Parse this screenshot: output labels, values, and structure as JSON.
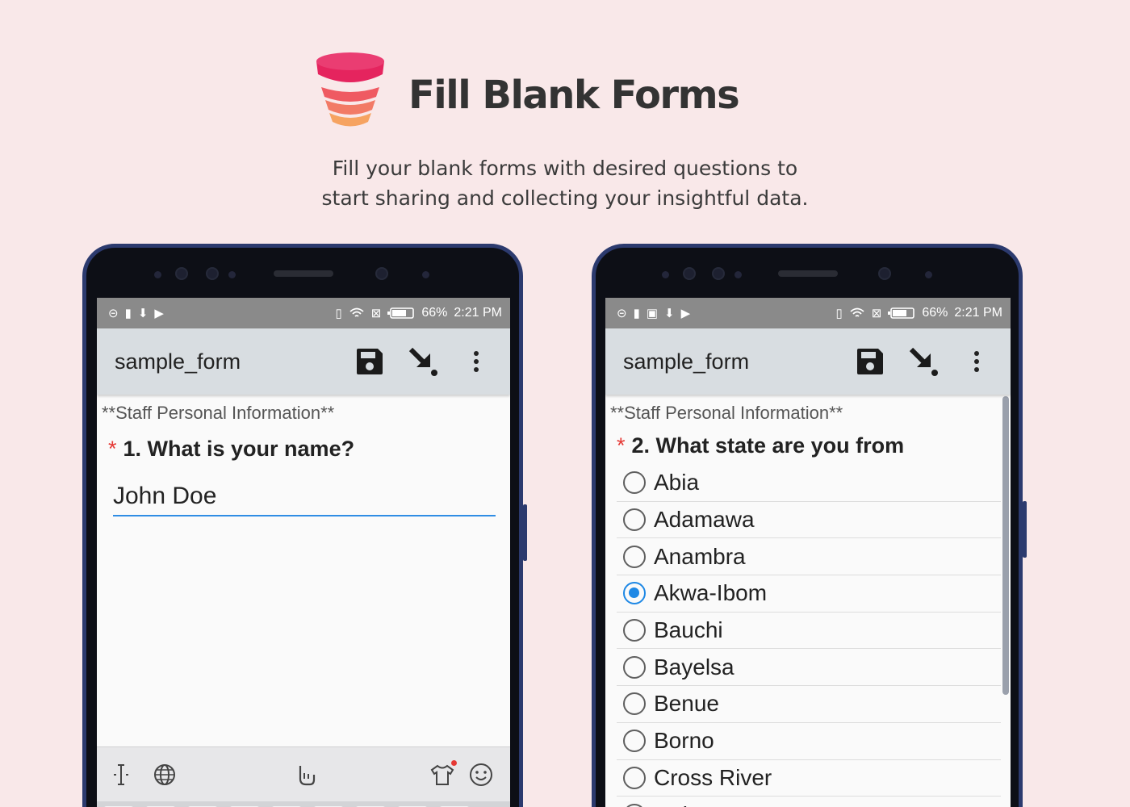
{
  "header": {
    "title": "Fill Blank Forms",
    "subtitle_line1": "Fill your blank forms with desired questions to",
    "subtitle_line2": "start sharing and collecting your insightful data."
  },
  "colors": {
    "background": "#f9e8e9",
    "logo_top": "#e5245e",
    "logo_bottom": "#f6a361",
    "accent_blue": "#1e88e5",
    "required_red": "#e53935"
  },
  "status_bar": {
    "battery": "66%",
    "time": "2:21 PM",
    "icons": [
      "notification-icon",
      "vibrate-icon",
      "wifi-icon",
      "sim-icon",
      "battery-icon"
    ]
  },
  "app_bar": {
    "title": "sample_form",
    "icons": [
      "save-icon",
      "jump-icon",
      "overflow-menu-icon"
    ]
  },
  "left_screen": {
    "section": "**Staff Personal Information**",
    "question_required_mark": "*",
    "question": "1. What is your name?",
    "answer_value": "John Doe",
    "keyboard_icons": [
      "cursor-icon",
      "globe-icon",
      "swipe-icon",
      "theme-icon",
      "emoji-icon"
    ]
  },
  "right_screen": {
    "section": "**Staff Personal Information**",
    "question_required_mark": "*",
    "question": "2. What state are you from",
    "options": [
      {
        "label": "Abia",
        "selected": false
      },
      {
        "label": "Adamawa",
        "selected": false
      },
      {
        "label": "Anambra",
        "selected": false
      },
      {
        "label": "Akwa-Ibom",
        "selected": true
      },
      {
        "label": "Bauchi",
        "selected": false
      },
      {
        "label": "Bayelsa",
        "selected": false
      },
      {
        "label": "Benue",
        "selected": false
      },
      {
        "label": "Borno",
        "selected": false
      },
      {
        "label": "Cross River",
        "selected": false
      },
      {
        "label": "Delta",
        "selected": false
      }
    ]
  }
}
